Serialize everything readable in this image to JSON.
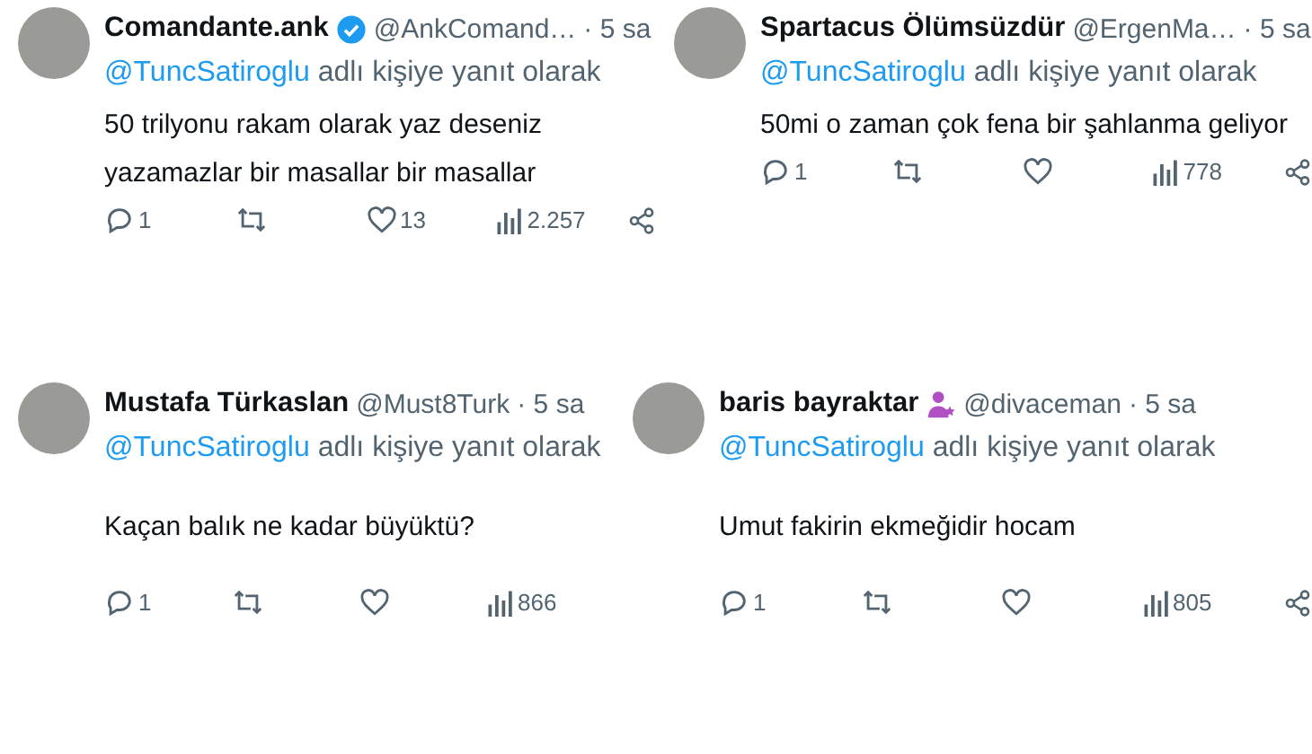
{
  "rows": [
    {
      "tweets": [
        {
          "name": "Comandante.ank",
          "verified": true,
          "handle": "@AnkComand…",
          "time": "· 5 sa",
          "reply_to": "@TuncSatiroglu",
          "reply_suffix": "adlı kişiye yanıt olarak",
          "body": [
            "50 trilyonu rakam olarak yaz deseniz",
            "yazamazlar bir masallar bir masallar"
          ],
          "replies": "1",
          "likes": "13",
          "views": "2.257",
          "share": true
        },
        {
          "name": "Spartacus Ölümsüzdür",
          "handle": "@ErgenMa…",
          "time": "· 5 sa",
          "reply_to": "@TuncSatiroglu",
          "reply_suffix": "adlı kişiye yanıt olarak",
          "body": [
            "50mi o zaman çok fena bir şahlanma geliyor"
          ],
          "replies": "1",
          "views": "778",
          "share": true
        }
      ]
    },
    {
      "tweets": [
        {
          "name": "Mustafa Türkaslan",
          "handle": "@Must8Turk",
          "time": "· 5 sa",
          "reply_to": "@TuncSatiroglu",
          "reply_suffix": "adlı kişiye yanıt olarak",
          "body": [
            "Kaçan balık ne kadar büyüktü?"
          ],
          "replies": "1",
          "views": "866",
          "share": false
        },
        {
          "name": "baris bayraktar",
          "affiliate": true,
          "handle": "@divaceman",
          "time": "· 5 sa",
          "reply_to": "@TuncSatiroglu",
          "reply_suffix": "adlı kişiye yanıt olarak",
          "body": [
            "Umut fakirin ekmeğidir hocam"
          ],
          "replies": "1",
          "views": "805",
          "share": true
        }
      ]
    }
  ]
}
